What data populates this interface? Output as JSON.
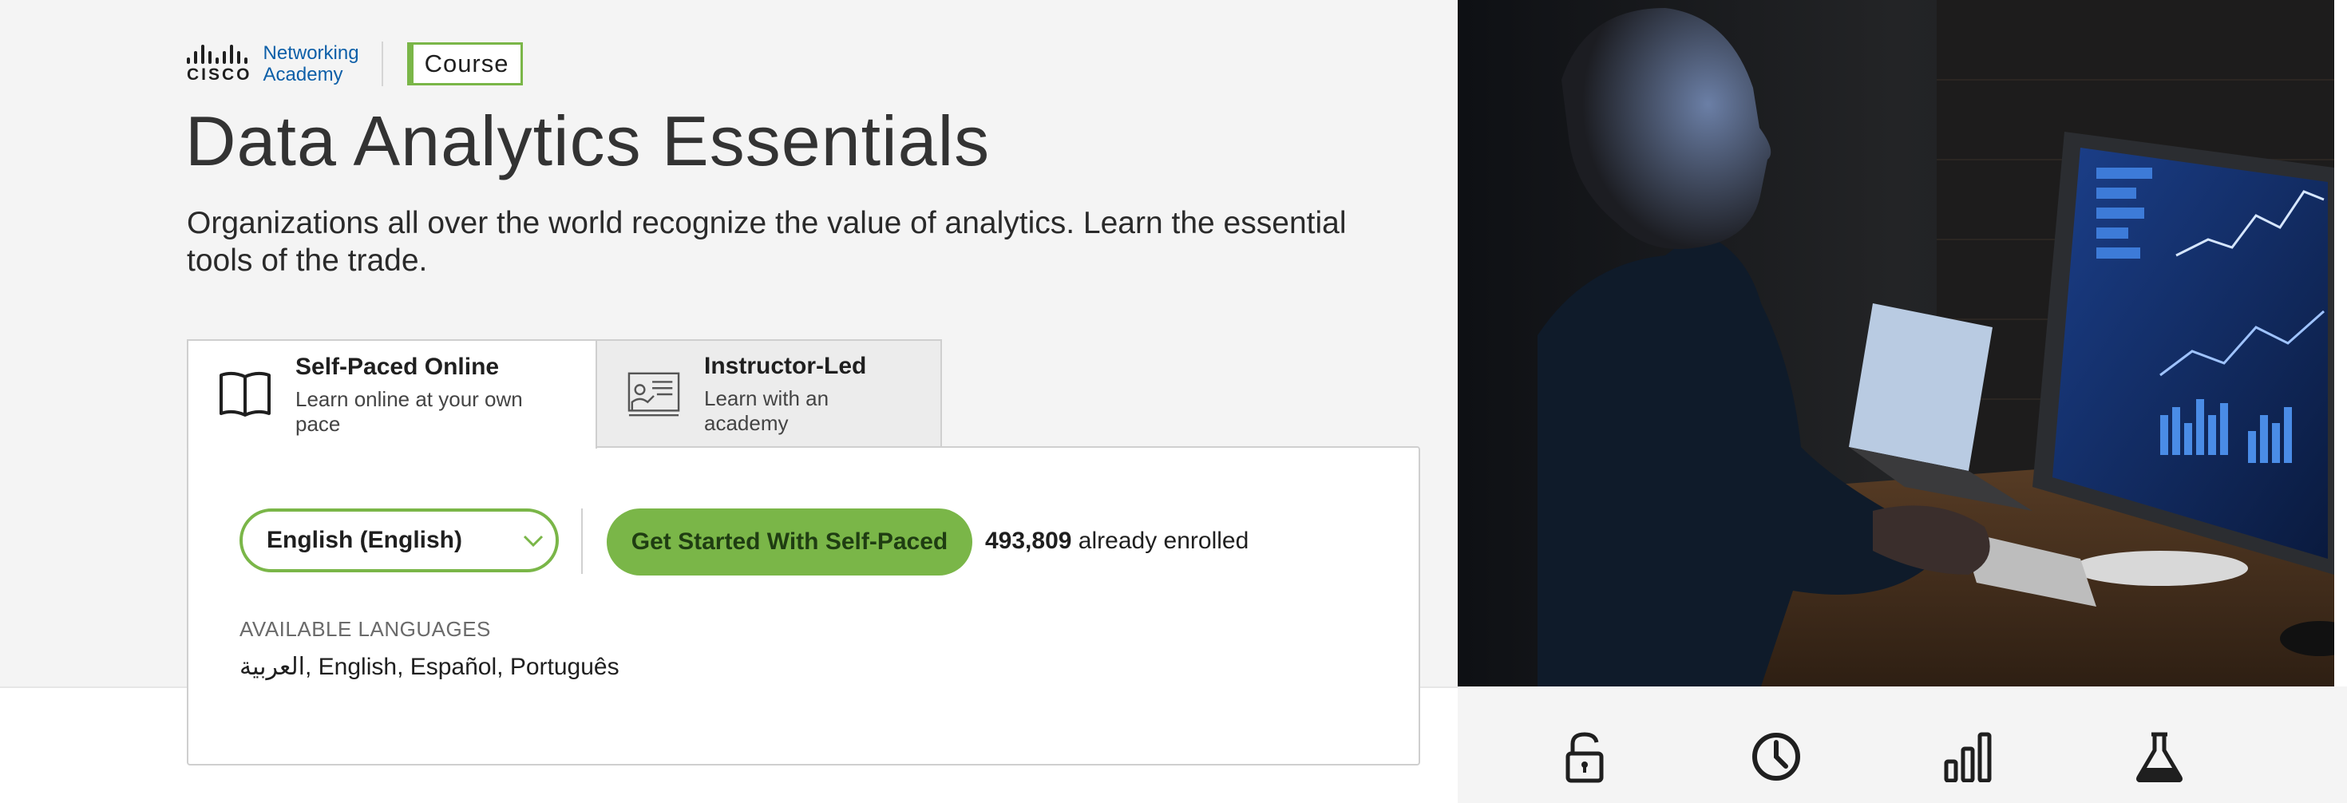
{
  "brand": {
    "logo_word": "CISCO",
    "netacad_line1": "Networking",
    "netacad_line2": "Academy",
    "badge": "Course"
  },
  "page": {
    "title": "Data Analytics Essentials",
    "description": "Organizations all over the world recognize the value of analytics. Learn the essential tools of the trade."
  },
  "tabs": [
    {
      "title": "Self-Paced Online",
      "subtitle": "Learn online at your own pace",
      "icon": "book-icon",
      "active": true
    },
    {
      "title": "Instructor-Led",
      "subtitle": "Learn with an academy",
      "icon": "instructor-icon",
      "active": false
    }
  ],
  "enroll": {
    "language_selected": "English (English)",
    "button_label": "Get Started With Self-Paced",
    "enrolled_count": "493,809",
    "enrolled_suffix": "already enrolled",
    "available_label": "AVAILABLE LANGUAGES",
    "available_list": "العربية, English, Español, Português"
  },
  "features": [
    {
      "icon": "unlock-icon"
    },
    {
      "icon": "clock-icon"
    },
    {
      "icon": "bar-chart-icon"
    },
    {
      "icon": "flask-icon"
    }
  ],
  "colors": {
    "accent_green": "#7ab648",
    "brand_blue": "#0d5fa8",
    "hero_bg": "#f4f4f4"
  }
}
